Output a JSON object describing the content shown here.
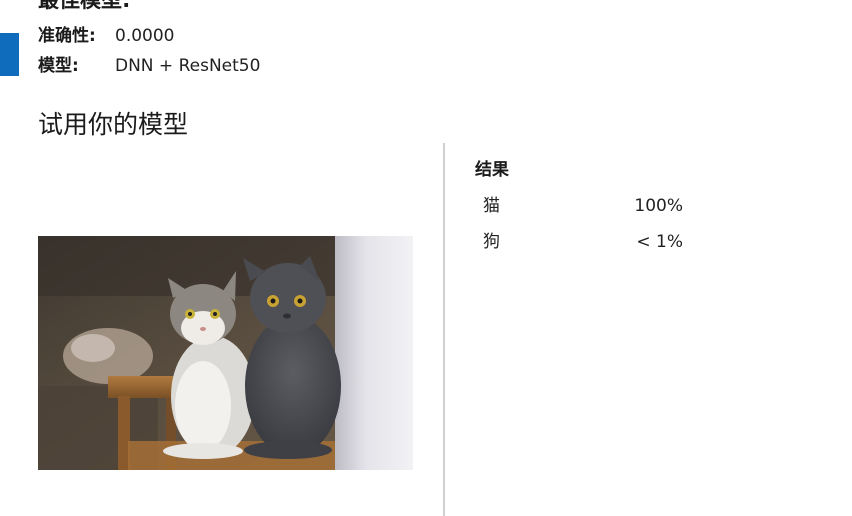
{
  "colors": {
    "accent": "#0F6CBD",
    "divider": "#d0d0d0"
  },
  "best_model": {
    "heading": "最佳模型:",
    "accuracy_label": "准确性:",
    "accuracy_value": "0.0000",
    "model_label": "模型:",
    "model_value": "DNN + ResNet50"
  },
  "try": {
    "title": "试用你的模型",
    "image_icon": "two-cats-photo"
  },
  "results": {
    "label": "结果",
    "items": [
      {
        "name": "猫",
        "value": "100%"
      },
      {
        "name": "狗",
        "value": "< 1%"
      }
    ]
  }
}
